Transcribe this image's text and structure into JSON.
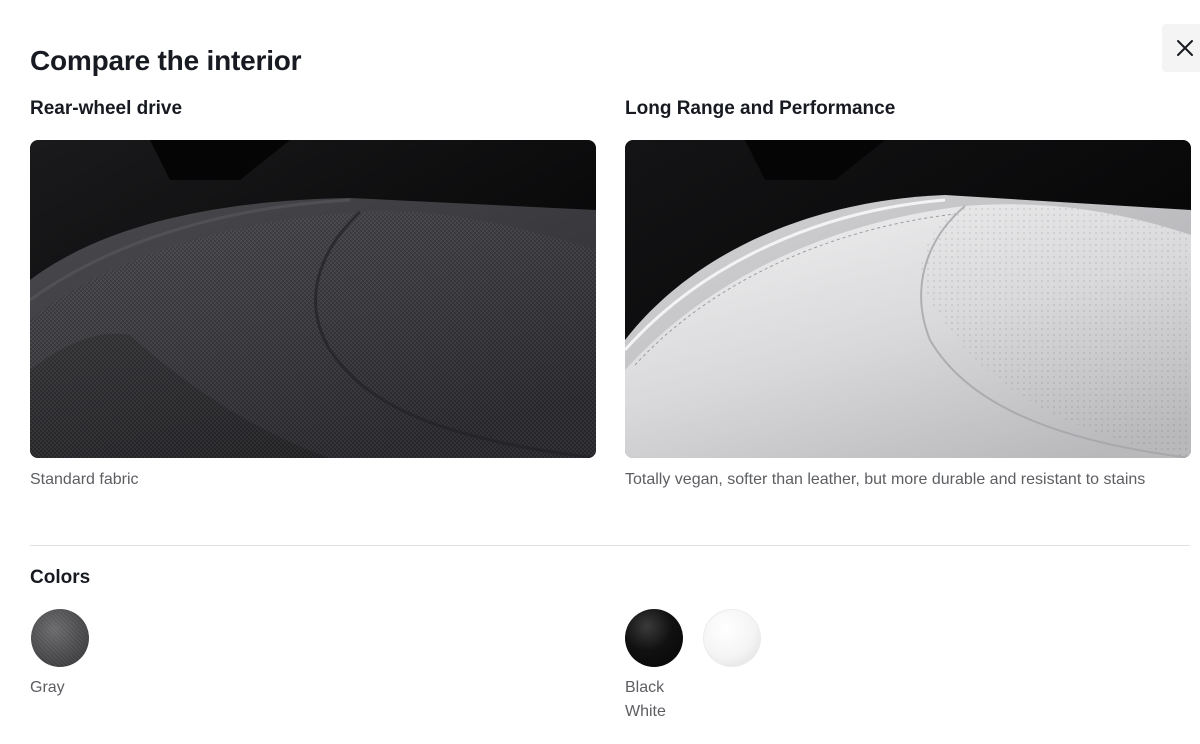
{
  "modal": {
    "title": "Compare the interior",
    "close_label": "×"
  },
  "left": {
    "heading": "Rear-wheel drive",
    "image": "fabric-seat-image",
    "caption": "Standard fabric"
  },
  "right": {
    "heading": "Long Range and Performance",
    "image": "vegan-leather-seat-image",
    "caption": "Totally vegan, softer than leather, but more durable and resistant to stains"
  },
  "colors": {
    "heading": "Colors",
    "left": {
      "swatches": [
        "gray"
      ],
      "labels": [
        "Gray"
      ]
    },
    "right": {
      "swatches": [
        "black",
        "white"
      ],
      "labels": [
        "Black",
        "White"
      ]
    }
  },
  "palette": {
    "text_primary": "#171a20",
    "text_secondary": "#5c5e62",
    "divider": "#e2e3e3",
    "close_bg": "#f4f4f4"
  }
}
